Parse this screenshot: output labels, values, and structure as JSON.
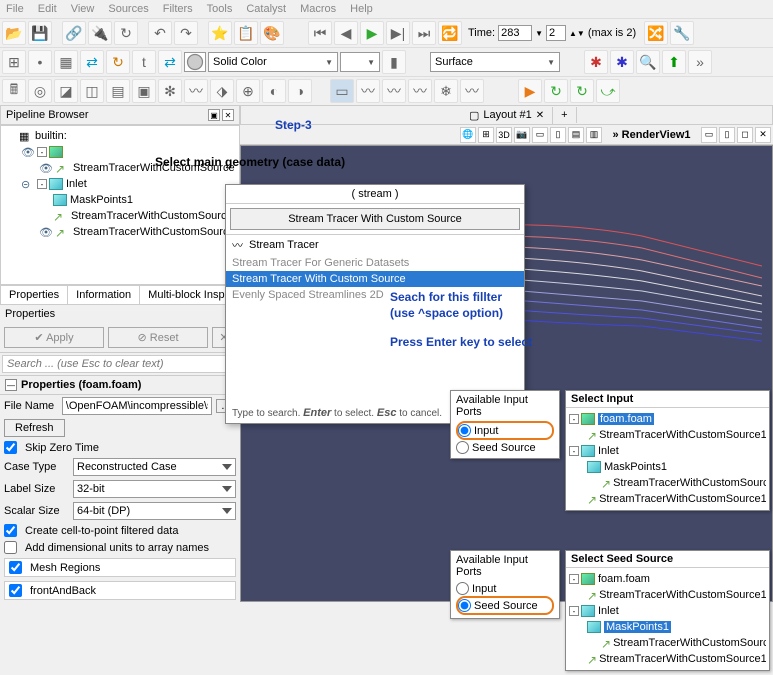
{
  "menu": [
    "File",
    "Edit",
    "View",
    "Sources",
    "Filters",
    "Tools",
    "Catalyst",
    "Macros",
    "Help"
  ],
  "time": {
    "label": "Time:",
    "frame": "283",
    "step": "2",
    "max": "(max is 2)"
  },
  "color_mode": "Solid Color",
  "repr_mode": "Surface",
  "pipeline_title": "Pipeline Browser",
  "step_label": "Step-3",
  "select_geom": "Select main geometry (case data)",
  "tree": {
    "root": "builtin:",
    "item1": "StreamTracerWithCustomSource",
    "item2": "Inlet",
    "item2a": "MaskPoints1",
    "item2b": "StreamTracerWithCustomSource",
    "item3": "StreamTracerWithCustomSource"
  },
  "tabs": {
    "properties": "Properties",
    "information": "Information",
    "multiblock": "Multi-block Insp"
  },
  "props_header": "Properties",
  "buttons": {
    "apply": "Apply",
    "reset": "Reset"
  },
  "search_placeholder": "Search ... (use Esc to clear text)",
  "section_title": "Properties (foam.foam)",
  "filename": {
    "label": "File Name",
    "value": "\\OpenFOAM\\incompressible\\simpleFoam\\pitzDail..."
  },
  "refresh": "Refresh",
  "skip_zero": "Skip Zero Time",
  "casetype": {
    "label": "Case Type",
    "value": "Reconstructed Case"
  },
  "labelsize": {
    "label": "Label Size",
    "value": "32-bit"
  },
  "scalarsize": {
    "label": "Scalar Size",
    "value": "64-bit (DP)"
  },
  "cell2point": "Create cell-to-point filtered data",
  "adddim": "Add dimensional units to array names",
  "mesh_regions": "Mesh Regions",
  "frontback": "frontAndBack",
  "layout_tab": "Layout #1",
  "renderview": "RenderView1",
  "filter": {
    "stream": "( stream )",
    "with_custom": "Stream Tracer With Custom Source",
    "tracer": "Stream Tracer",
    "generic": "Stream Tracer For Generic Datasets",
    "selected": "Stream Tracer With Custom Source",
    "evenly": "Evenly Spaced Streamlines 2D",
    "hint": "Type to search. Enter to select. Esc to cancel."
  },
  "ann": {
    "search": "Seach for this fillter\n(use ^space option)",
    "press": "Press Enter key to select"
  },
  "ports": {
    "title": "Available Input Ports",
    "input": "Input",
    "seed": "Seed Source"
  },
  "select_input": "Select Input",
  "select_seed": "Select Seed Source",
  "sel_tree": {
    "foam": "foam.foam",
    "st1": "StreamTracerWithCustomSource1",
    "inlet": "Inlet",
    "mask": "MaskPoints1",
    "st2": "StreamTracerWithCustomSource1"
  }
}
